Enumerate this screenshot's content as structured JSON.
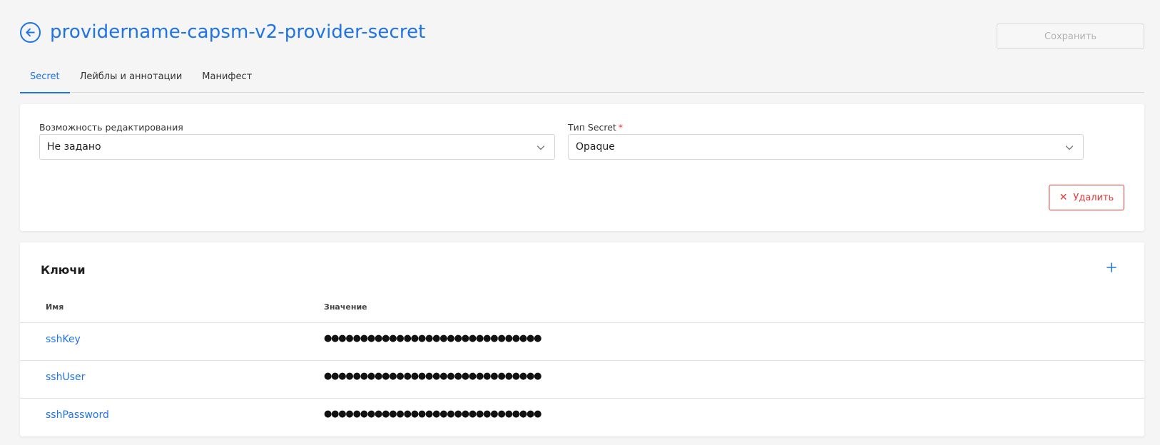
{
  "header": {
    "title": "providername-capsm-v2-provider-secret",
    "save_label": "Сохранить"
  },
  "tabs": [
    {
      "label": "Secret",
      "active": true
    },
    {
      "label": "Лейблы и аннотации",
      "active": false
    },
    {
      "label": "Манифест",
      "active": false
    }
  ],
  "settings": {
    "editability": {
      "label": "Возможность редактирования",
      "value": "Не задано"
    },
    "secret_type": {
      "label": "Тип Secret",
      "required_mark": "*",
      "value": "Opaque"
    },
    "delete_label": "Удалить"
  },
  "keys": {
    "title": "Ключи",
    "columns": {
      "name": "Имя",
      "value": "Значение"
    },
    "rows": [
      {
        "name": "sshKey",
        "value": "●●●●●●●●●●●●●●●●●●●●●●●●●●●●●●"
      },
      {
        "name": "sshUser",
        "value": "●●●●●●●●●●●●●●●●●●●●●●●●●●●●●●"
      },
      {
        "name": "sshPassword",
        "value": "●●●●●●●●●●●●●●●●●●●●●●●●●●●●●●"
      }
    ]
  },
  "colors": {
    "accent": "#1f73e8",
    "danger": "#e53935",
    "background": "#f5f5f5"
  },
  "icons": {
    "back": "arrow-left-circle-icon",
    "select": "chevron-down-icon",
    "delete": "close-icon",
    "add": "plus-icon"
  }
}
